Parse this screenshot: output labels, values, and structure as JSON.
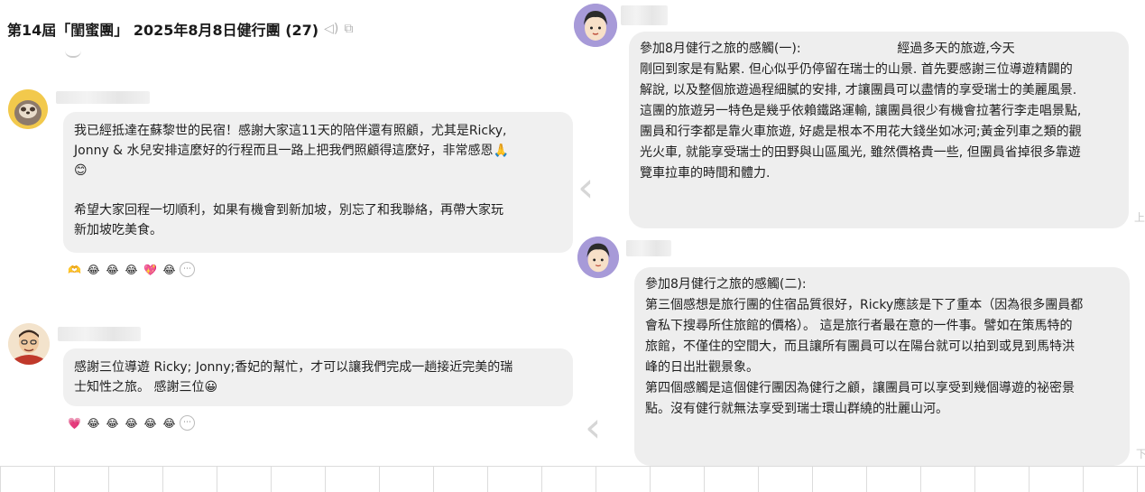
{
  "header": {
    "title": "第14屆「閨蜜團」 2025年8月8日健行團 (27)",
    "icons": [
      "speaker-icon",
      "open-external-icon"
    ]
  },
  "left_messages": [
    {
      "avatar": "sloth-avatar",
      "paragraphs": [
        "我已經抵達在蘇黎世的民宿！感謝大家這11天的陪伴還有照顧，尤其是Ricky,",
        "Jonny & 水兒安排這麼好的行程而且一路上把我們照顧得這麼好，非常感恩🙏",
        "😊",
        "希望大家回程一切順利，如果有機會到新加坡，別忘了和我聯絡，再帶大家玩",
        "新加坡吃美食。"
      ],
      "reactions": [
        "🫶",
        "😂",
        "😂",
        "😂",
        "💖",
        "😂",
        "⋯"
      ]
    },
    {
      "avatar": "man-avatar",
      "paragraphs": [
        "感謝三位導遊 Ricky; Jonny;香妃的幫忙，才可以讓我們完成一趟接近完美的瑞",
        "士知性之旅。 感謝三位😀"
      ],
      "reactions": [
        "💗",
        "😂",
        "😂",
        "😂",
        "😂",
        "😂",
        "⋯"
      ]
    }
  ],
  "right_messages": [
    {
      "avatar": "woman-avatar",
      "lines": [
        "參加8月健行之旅的感觸(一):                        經過多天的旅遊,今天",
        "剛回到家是有點累. 但心似乎仍停留在瑞士的山景. 首先要感謝三位導遊精闢的",
        "解說, 以及整個旅遊過程細膩的安排, 才讓團員可以盡情的享受瑞士的美麗風景.",
        "這團的旅遊另一特色是幾乎依賴鐵路運輸, 讓團員很少有機會拉著行李走唱景點,",
        "團員和行李都是靠火車旅遊, 好處是根本不用花大錢坐如冰河;黃金列車之類的觀",
        "光火車, 就能享受瑞士的田野與山區風光, 雖然價格貴一些, 但團員省掉很多靠遊",
        "覽車拉車的時間和體力."
      ]
    },
    {
      "avatar": "woman-avatar",
      "lines": [
        "參加8月健行之旅的感觸(二):",
        "第三個感想是旅行團的住宿品質很好，Ricky應該是下了重本（因為很多團員都",
        "會私下搜尋所住旅館的價格）。 這是旅行者最在意的一件事。譬如在策馬特的",
        "旅館，不僅住的空間大，而且讓所有團員可以在陽台就可以拍到或見到馬特洪",
        "峰的日出壯觀景象。",
        "第四個感觸是這個健行團因為健行之顧，讓團員可以享受到幾個導遊的祕密景",
        "點。沒有健行就無法享受到瑞士環山群繞的壯麗山河。"
      ]
    }
  ],
  "side_labels": [
    "上",
    "下"
  ]
}
